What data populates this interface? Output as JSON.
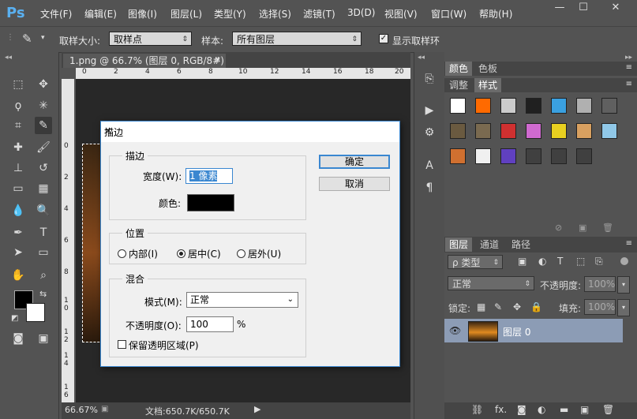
{
  "app": {
    "logo": "Ps"
  },
  "menu": [
    "文件(F)",
    "编辑(E)",
    "图像(I)",
    "图层(L)",
    "类型(Y)",
    "选择(S)",
    "滤镜(T)",
    "3D(D)",
    "视图(V)",
    "窗口(W)",
    "帮助(H)"
  ],
  "window_controls": {
    "minimize": "—",
    "maximize": "☐",
    "close": "✕"
  },
  "options_bar": {
    "sample_size_label": "取样大小:",
    "sample_size_value": "取样点",
    "sample_label": "样本:",
    "sample_value": "所有图层",
    "show_ring_label": "显示取样环",
    "show_ring_checked": true
  },
  "document": {
    "tab_title": "1.png @ 66.7% (图层 0, RGB/8#)",
    "tab_close": "✕",
    "ruler_h": [
      "0",
      "2",
      "4",
      "6",
      "8",
      "10",
      "12",
      "14",
      "16",
      "18",
      "20"
    ],
    "ruler_v": [
      "0",
      "2",
      "4",
      "6",
      "8",
      "1 0",
      "1 2",
      "1 4",
      "1 6"
    ],
    "zoom": "66.67%",
    "doc_info": "文档:650.7K/650.7K"
  },
  "color_panel": {
    "tabs": [
      "颜色",
      "色板"
    ],
    "sub_tabs": [
      "调整",
      "样式"
    ],
    "active_sub": "样式"
  },
  "style_swatches": [
    "#ffffff",
    "#ff6a00",
    "#cccccc",
    "#202020",
    "#3aa0e0",
    "#b0b0b0",
    "#606060",
    "#6a5a40",
    "#7a6a50",
    "#d03030",
    "#d06ad0",
    "#e8d020",
    "#d8a060",
    "#90c8e8",
    "#d07030",
    "#f0f0f0",
    "#6040c0",
    "#404040",
    "#404040",
    "#404040"
  ],
  "layers_panel": {
    "tabs": [
      "图层",
      "通道",
      "路径"
    ],
    "kind_filter": "ρ 类型",
    "blend_mode": "正常",
    "opacity_label": "不透明度:",
    "opacity_value": "100%",
    "lock_label": "锁定:",
    "fill_label": "填充:",
    "fill_value": "100%",
    "layers": [
      {
        "name": "图层 0",
        "visible": true
      }
    ],
    "footer_icons": [
      "link-icon",
      "fx-icon",
      "mask-icon",
      "adjustment-icon",
      "group-icon",
      "new-layer-icon",
      "delete-icon"
    ],
    "fx_text": "fx."
  },
  "dialog": {
    "title": "描边",
    "close": "✕",
    "stroke_group": "描边",
    "width_label": "宽度(W):",
    "width_value": "1 像素",
    "color_label": "颜色:",
    "color_value": "#000000",
    "position_group": "位置",
    "positions": [
      {
        "label": "内部(I)",
        "selected": false
      },
      {
        "label": "居中(C)",
        "selected": true
      },
      {
        "label": "居外(U)",
        "selected": false
      }
    ],
    "blend_group": "混合",
    "mode_label": "模式(M):",
    "mode_value": "正常",
    "opacity_label": "不透明度(O):",
    "opacity_value": "100",
    "opacity_unit": "%",
    "preserve_label": "保留透明区域(P)",
    "preserve_checked": false,
    "ok_label": "确定",
    "cancel_label": "取消"
  }
}
